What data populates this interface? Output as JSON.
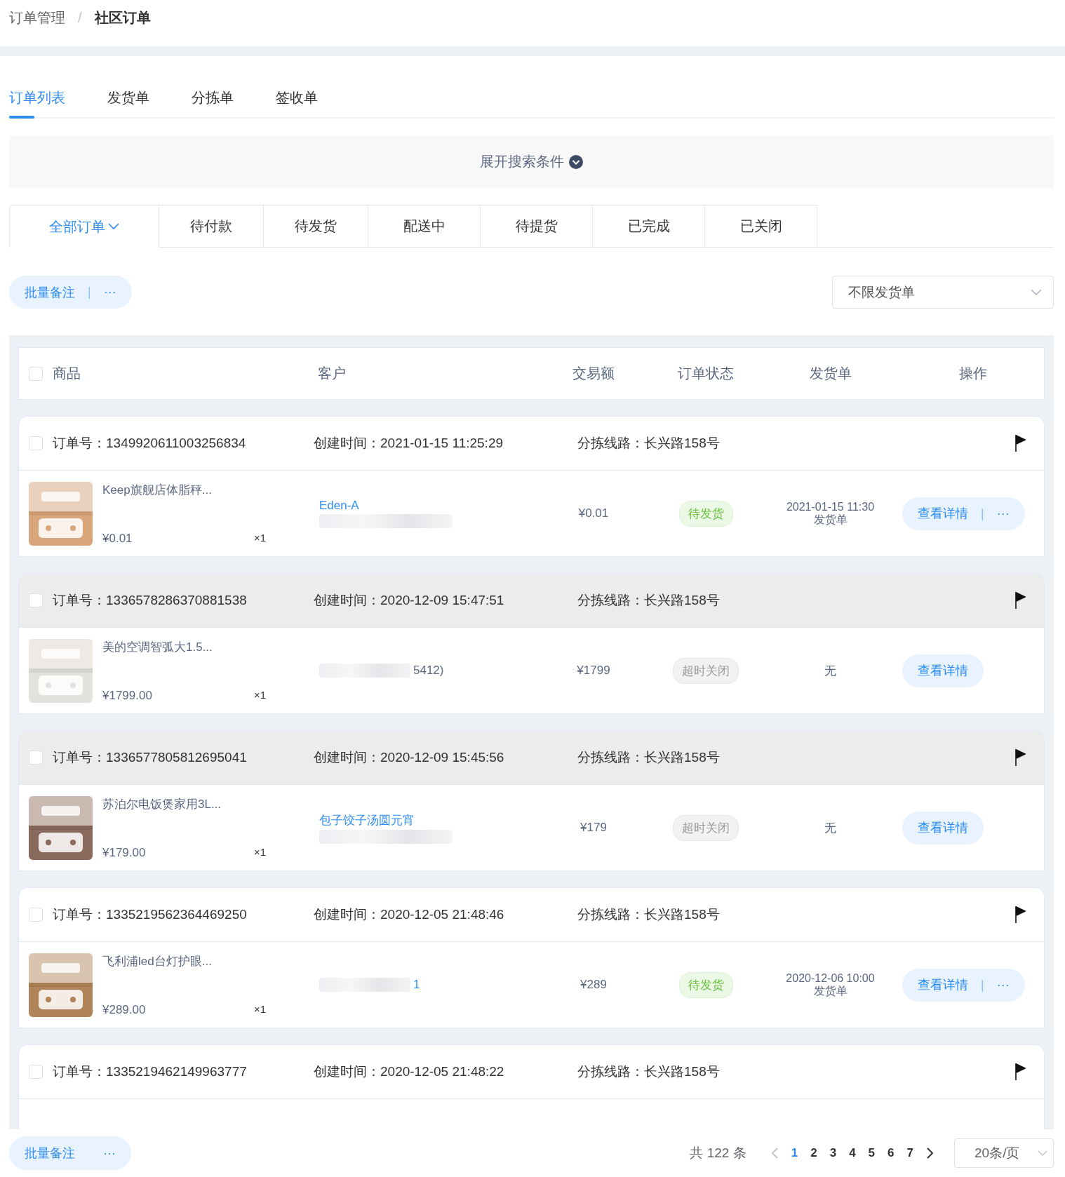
{
  "breadcrumb": [
    {
      "label": "订单管理",
      "current": false
    },
    {
      "label": "社区订单",
      "current": true
    }
  ],
  "breadcrumb_separator": "/",
  "tabs": [
    {
      "label": "订单列表",
      "selected": true
    },
    {
      "label": "发货单",
      "selected": false
    },
    {
      "label": "分拣单",
      "selected": false
    },
    {
      "label": "签收单",
      "selected": false
    }
  ],
  "search_toggle": {
    "label": "展开搜索条件"
  },
  "status_tabs": [
    {
      "label": "全部订单",
      "selected": true,
      "dropdown": true
    },
    {
      "label": "待付款",
      "selected": false,
      "dropdown": false
    },
    {
      "label": "待发货",
      "selected": false,
      "dropdown": false
    },
    {
      "label": "配送中",
      "selected": false,
      "dropdown": false
    },
    {
      "label": "待提货",
      "selected": false,
      "dropdown": false
    },
    {
      "label": "已完成",
      "selected": false,
      "dropdown": false
    },
    {
      "label": "已关闭",
      "selected": false,
      "dropdown": false
    }
  ],
  "toolbar": {
    "batch_button": {
      "label": "批量备注",
      "separator": "|",
      "more": "···"
    },
    "shipment_filter": {
      "value": "不限发货单"
    }
  },
  "table": {
    "select_all": {
      "checked": false
    },
    "columns": [
      "商品",
      "客户",
      "交易额",
      "订单状态",
      "发货单",
      "操作"
    ],
    "orders": [
      {
        "checked": false,
        "highlighted": false,
        "order_no_label": "订单号：",
        "order_no": "1349920611003256834",
        "created_label": "创建时间：",
        "created": "2021-01-15 11:25:29",
        "route_label": "分拣线路：",
        "route": "长兴路158号",
        "product": {
          "kind": "picture",
          "name": "Keep旗舰店体脂秤...",
          "price": "¥0.01",
          "qty": "×1"
        },
        "customer": {
          "name": "Eden-A"
        },
        "amount": "¥0.01",
        "status": {
          "label": "待发货",
          "kind": "pending"
        },
        "shipment": {
          "time": "2021-01-15 11:30",
          "label": "发货单"
        },
        "action": {
          "label": "查看详情",
          "separator": "|",
          "more": "···"
        }
      },
      {
        "checked": false,
        "highlighted": true,
        "order_no_label": "订单号：",
        "order_no": "1336578286370881538",
        "created_label": "创建时间：",
        "created": "2020-12-09 15:47:51",
        "route_label": "分拣线路：",
        "route": "长兴路158号",
        "product": {
          "kind": "picture",
          "name": "美的空调智弧大1.5...",
          "price": "¥1799.00",
          "qty": "×1"
        },
        "customer": {
          "fragment_after": "5412)"
        },
        "amount": "¥1799",
        "status": {
          "label": "超时关闭",
          "kind": "closed"
        },
        "shipment": {
          "none": "无"
        },
        "action": {
          "label": "查看详情"
        }
      },
      {
        "checked": false,
        "highlighted": true,
        "order_no_label": "订单号：",
        "order_no": "1336577805812695041",
        "created_label": "创建时间：",
        "created": "2020-12-09 15:45:56",
        "route_label": "分拣线路：",
        "route": "长兴路158号",
        "product": {
          "kind": "picture",
          "name": "苏泊尔电饭煲家用3L...",
          "price": "¥179.00",
          "qty": "×1"
        },
        "customer": {
          "name": "包子饺子汤圆元宵"
        },
        "amount": "¥179",
        "status": {
          "label": "超时关闭",
          "kind": "closed"
        },
        "shipment": {
          "none": "无"
        },
        "action": {
          "label": "查看详情"
        }
      },
      {
        "checked": false,
        "highlighted": false,
        "order_no_label": "订单号：",
        "order_no": "1335219562364469250",
        "created_label": "创建时间：",
        "created": "2020-12-05 21:48:46",
        "route_label": "分拣线路：",
        "route": "长兴路158号",
        "product": {
          "kind": "picture",
          "name": "飞利浦led台灯护眼...",
          "price": "¥289.00",
          "qty": "×1"
        },
        "customer": {
          "fragment_after": "1"
        },
        "amount": "¥289",
        "status": {
          "label": "待发货",
          "kind": "pending"
        },
        "shipment": {
          "time": "2020-12-06 10:00",
          "label": "发货单"
        },
        "action": {
          "label": "查看详情",
          "separator": "|",
          "more": "···"
        }
      },
      {
        "checked": false,
        "highlighted": false,
        "order_no_label": "订单号：",
        "order_no": "1335219462149963777",
        "created_label": "创建时间：",
        "created": "2020-12-05 21:48:22",
        "route_label": "分拣线路：",
        "route": "长兴路158号"
      }
    ]
  },
  "footer": {
    "batch_button": {
      "label": "批量备注",
      "more": "···"
    },
    "total": "共 122 条",
    "pages": [
      {
        "label": "1",
        "selected": true
      },
      {
        "label": "2",
        "selected": false
      },
      {
        "label": "3",
        "selected": false
      },
      {
        "label": "4",
        "selected": false
      },
      {
        "label": "5",
        "selected": false
      },
      {
        "label": "6",
        "selected": false
      },
      {
        "label": "7",
        "selected": false
      }
    ],
    "page_size": "20条/页"
  }
}
